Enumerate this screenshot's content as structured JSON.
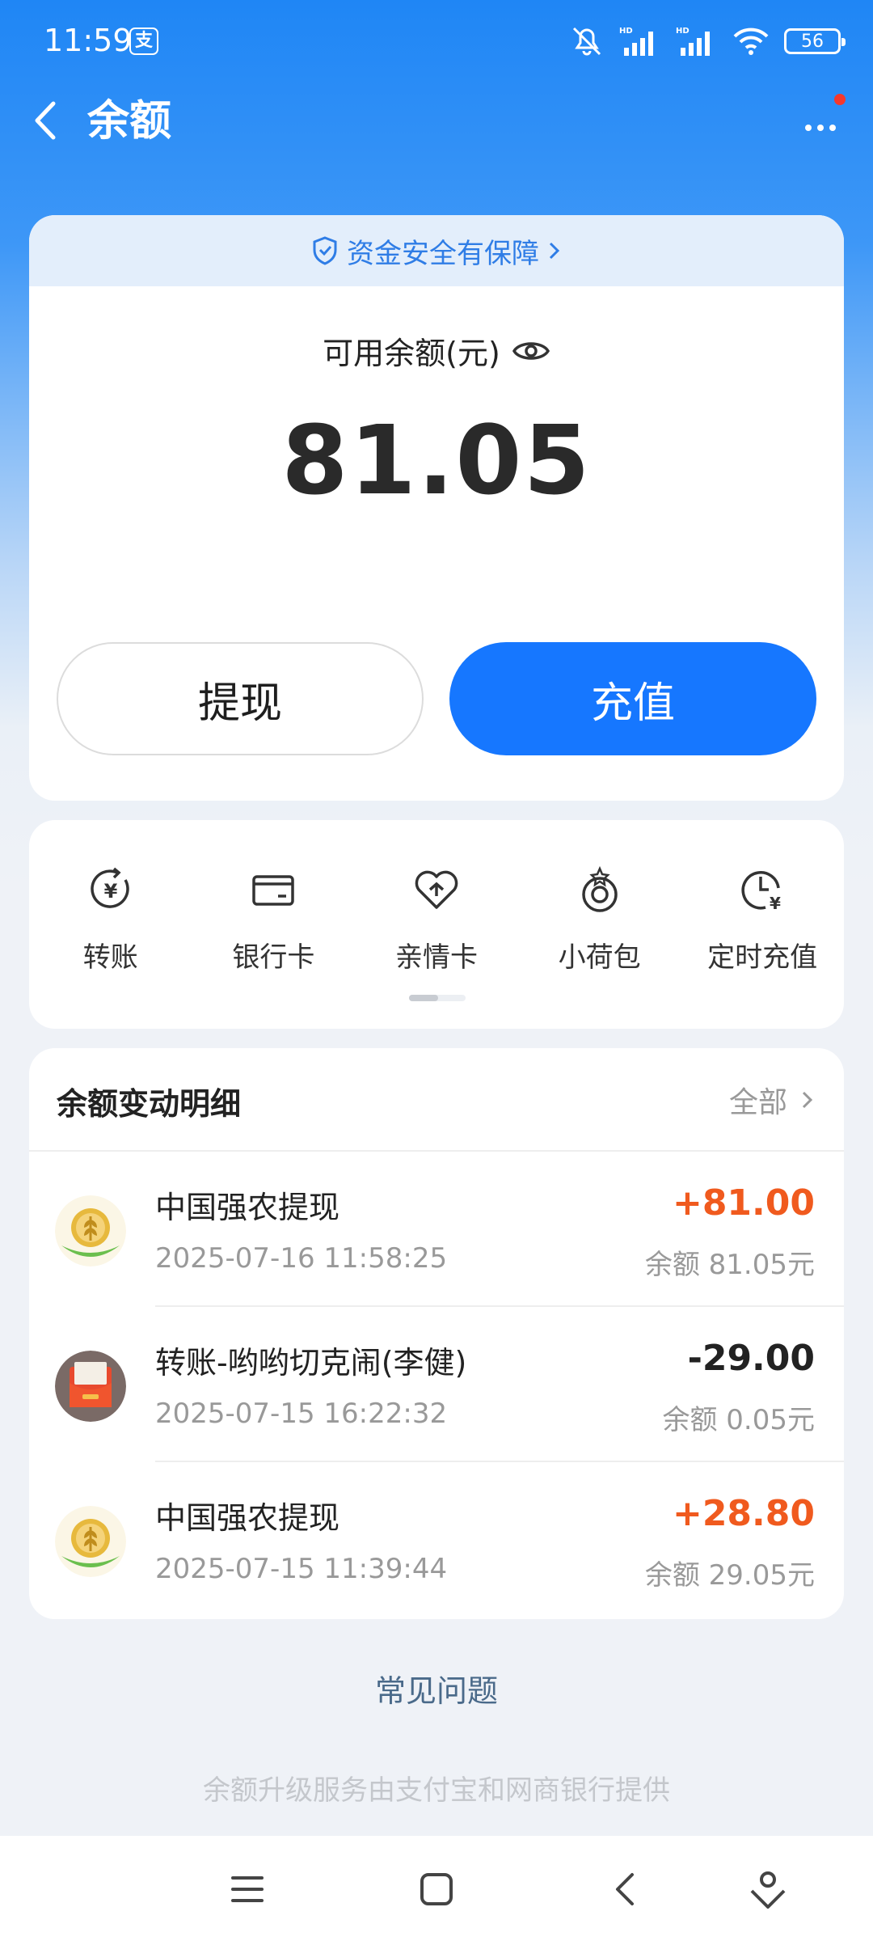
{
  "status_bar": {
    "time": "11:59",
    "app_badge": "支",
    "battery": "56"
  },
  "header": {
    "title": "余额"
  },
  "balance_card": {
    "security_text": "资金安全有保障",
    "label": "可用余额(元)",
    "amount": "81.05",
    "withdraw_label": "提现",
    "topup_label": "充值"
  },
  "shortcuts": [
    {
      "label": "转账",
      "icon": "transfer-icon"
    },
    {
      "label": "银行卡",
      "icon": "bank-card-icon"
    },
    {
      "label": "亲情卡",
      "icon": "family-card-icon"
    },
    {
      "label": "小荷包",
      "icon": "small-wallet-icon"
    },
    {
      "label": "定时充值",
      "icon": "scheduled-topup-icon"
    }
  ],
  "transactions": {
    "title": "余额变动明细",
    "all_label": "全部",
    "items": [
      {
        "name": "中国强农提现",
        "time": "2025-07-16 11:58:25",
        "amount": "+81.00",
        "balance": "余额 81.05元",
        "direction": "in"
      },
      {
        "name": "转账-哟哟切克闹(李健)",
        "time": "2025-07-15 16:22:32",
        "amount": "-29.00",
        "balance": "余额 0.05元",
        "direction": "out"
      },
      {
        "name": "中国强农提现",
        "time": "2025-07-15 11:39:44",
        "amount": "+28.80",
        "balance": "余额 29.05元",
        "direction": "in"
      }
    ]
  },
  "faq_label": "常见问题",
  "footer_note": "余额升级服务由支付宝和网商银行提供",
  "colors": {
    "brand_blue": "#1677ff",
    "income_orange": "#f05a1e"
  }
}
